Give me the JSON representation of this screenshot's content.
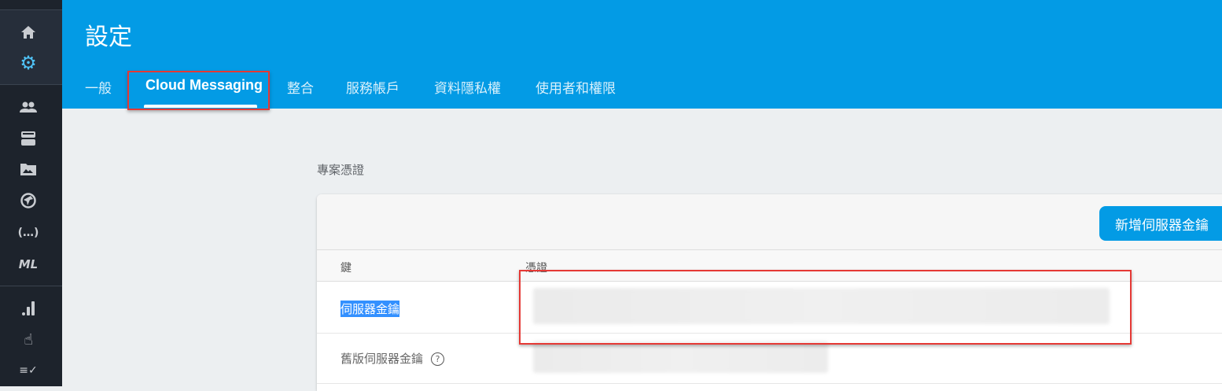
{
  "sidebar": {
    "items": [
      {
        "icon": "home-icon",
        "glyph": "⌂"
      },
      {
        "icon": "gear-icon",
        "glyph": "⚙"
      },
      {
        "icon": "users-icon",
        "glyph": "👥"
      },
      {
        "icon": "database-icon",
        "glyph": "☰"
      },
      {
        "icon": "storage-folder-icon",
        "glyph": "▬"
      },
      {
        "icon": "hosting-globe-icon",
        "glyph": "◍"
      },
      {
        "icon": "functions-icon",
        "glyph": "(…)"
      },
      {
        "icon": "ml-icon",
        "glyph": "ML"
      },
      {
        "icon": "analytics-icon",
        "glyph": ".ıl"
      },
      {
        "icon": "touch-icon",
        "glyph": "☝"
      },
      {
        "icon": "checklist-icon",
        "glyph": "≡✓"
      }
    ],
    "active_color": "#4fc3f7"
  },
  "header": {
    "title": "設定",
    "tabs": [
      {
        "label": "一般"
      },
      {
        "label": "Cloud Messaging",
        "active": true
      },
      {
        "label": "整合"
      },
      {
        "label": "服務帳戶"
      },
      {
        "label": "資料隱私權"
      },
      {
        "label": "使用者和權限"
      }
    ],
    "color": "#039be5"
  },
  "main": {
    "section_label": "專案憑證",
    "add_button": "新增伺服器金鑰",
    "columns": [
      "鍵",
      "憑證"
    ],
    "rows": [
      {
        "key": "伺服器金鑰",
        "selected": true
      },
      {
        "key": "舊版伺服器金鑰",
        "help": "?"
      }
    ]
  },
  "highlight_color": "#e53935"
}
